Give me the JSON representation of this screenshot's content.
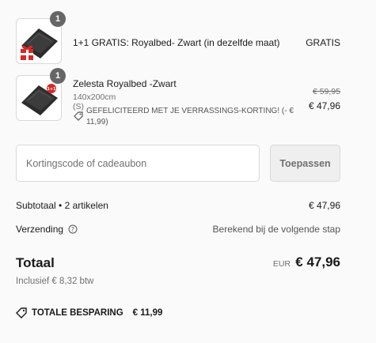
{
  "items": [
    {
      "quantity": "1",
      "name": "1+1 GRATIS: Royalbed- Zwart (in dezelfde maat)",
      "price": "GRATIS",
      "image_icon": "duvet-gift-icon"
    },
    {
      "quantity": "1",
      "name": "Zelesta Royalbed -Zwart",
      "variant": "140x200cm (S)",
      "discount_text": "GEFELICITEERD MET JE VERRASSINGS-KORTING! (- € 11,99)",
      "old_price": "€ 59,95",
      "price": "€ 47,96",
      "image_icon": "duvet-icon"
    }
  ],
  "discount": {
    "placeholder": "Kortingscode of cadeaubon",
    "apply_label": "Toepassen"
  },
  "summary": {
    "subtotal_label": "Subtotaal • 2 artikelen",
    "subtotal_value": "€ 47,96",
    "shipping_label": "Verzending",
    "shipping_value": "Berekend bij de volgende stap",
    "total_label": "Totaal",
    "total_currency": "EUR",
    "total_value": "€ 47,96",
    "tax_text": "Inclusief € 8,32 btw",
    "savings_label": "TOTALE BESPARING",
    "savings_value": "€ 11,99"
  },
  "colors": {
    "badge": "#666666",
    "gift_red": "#d62828",
    "duvet": "#2b2b2b"
  }
}
